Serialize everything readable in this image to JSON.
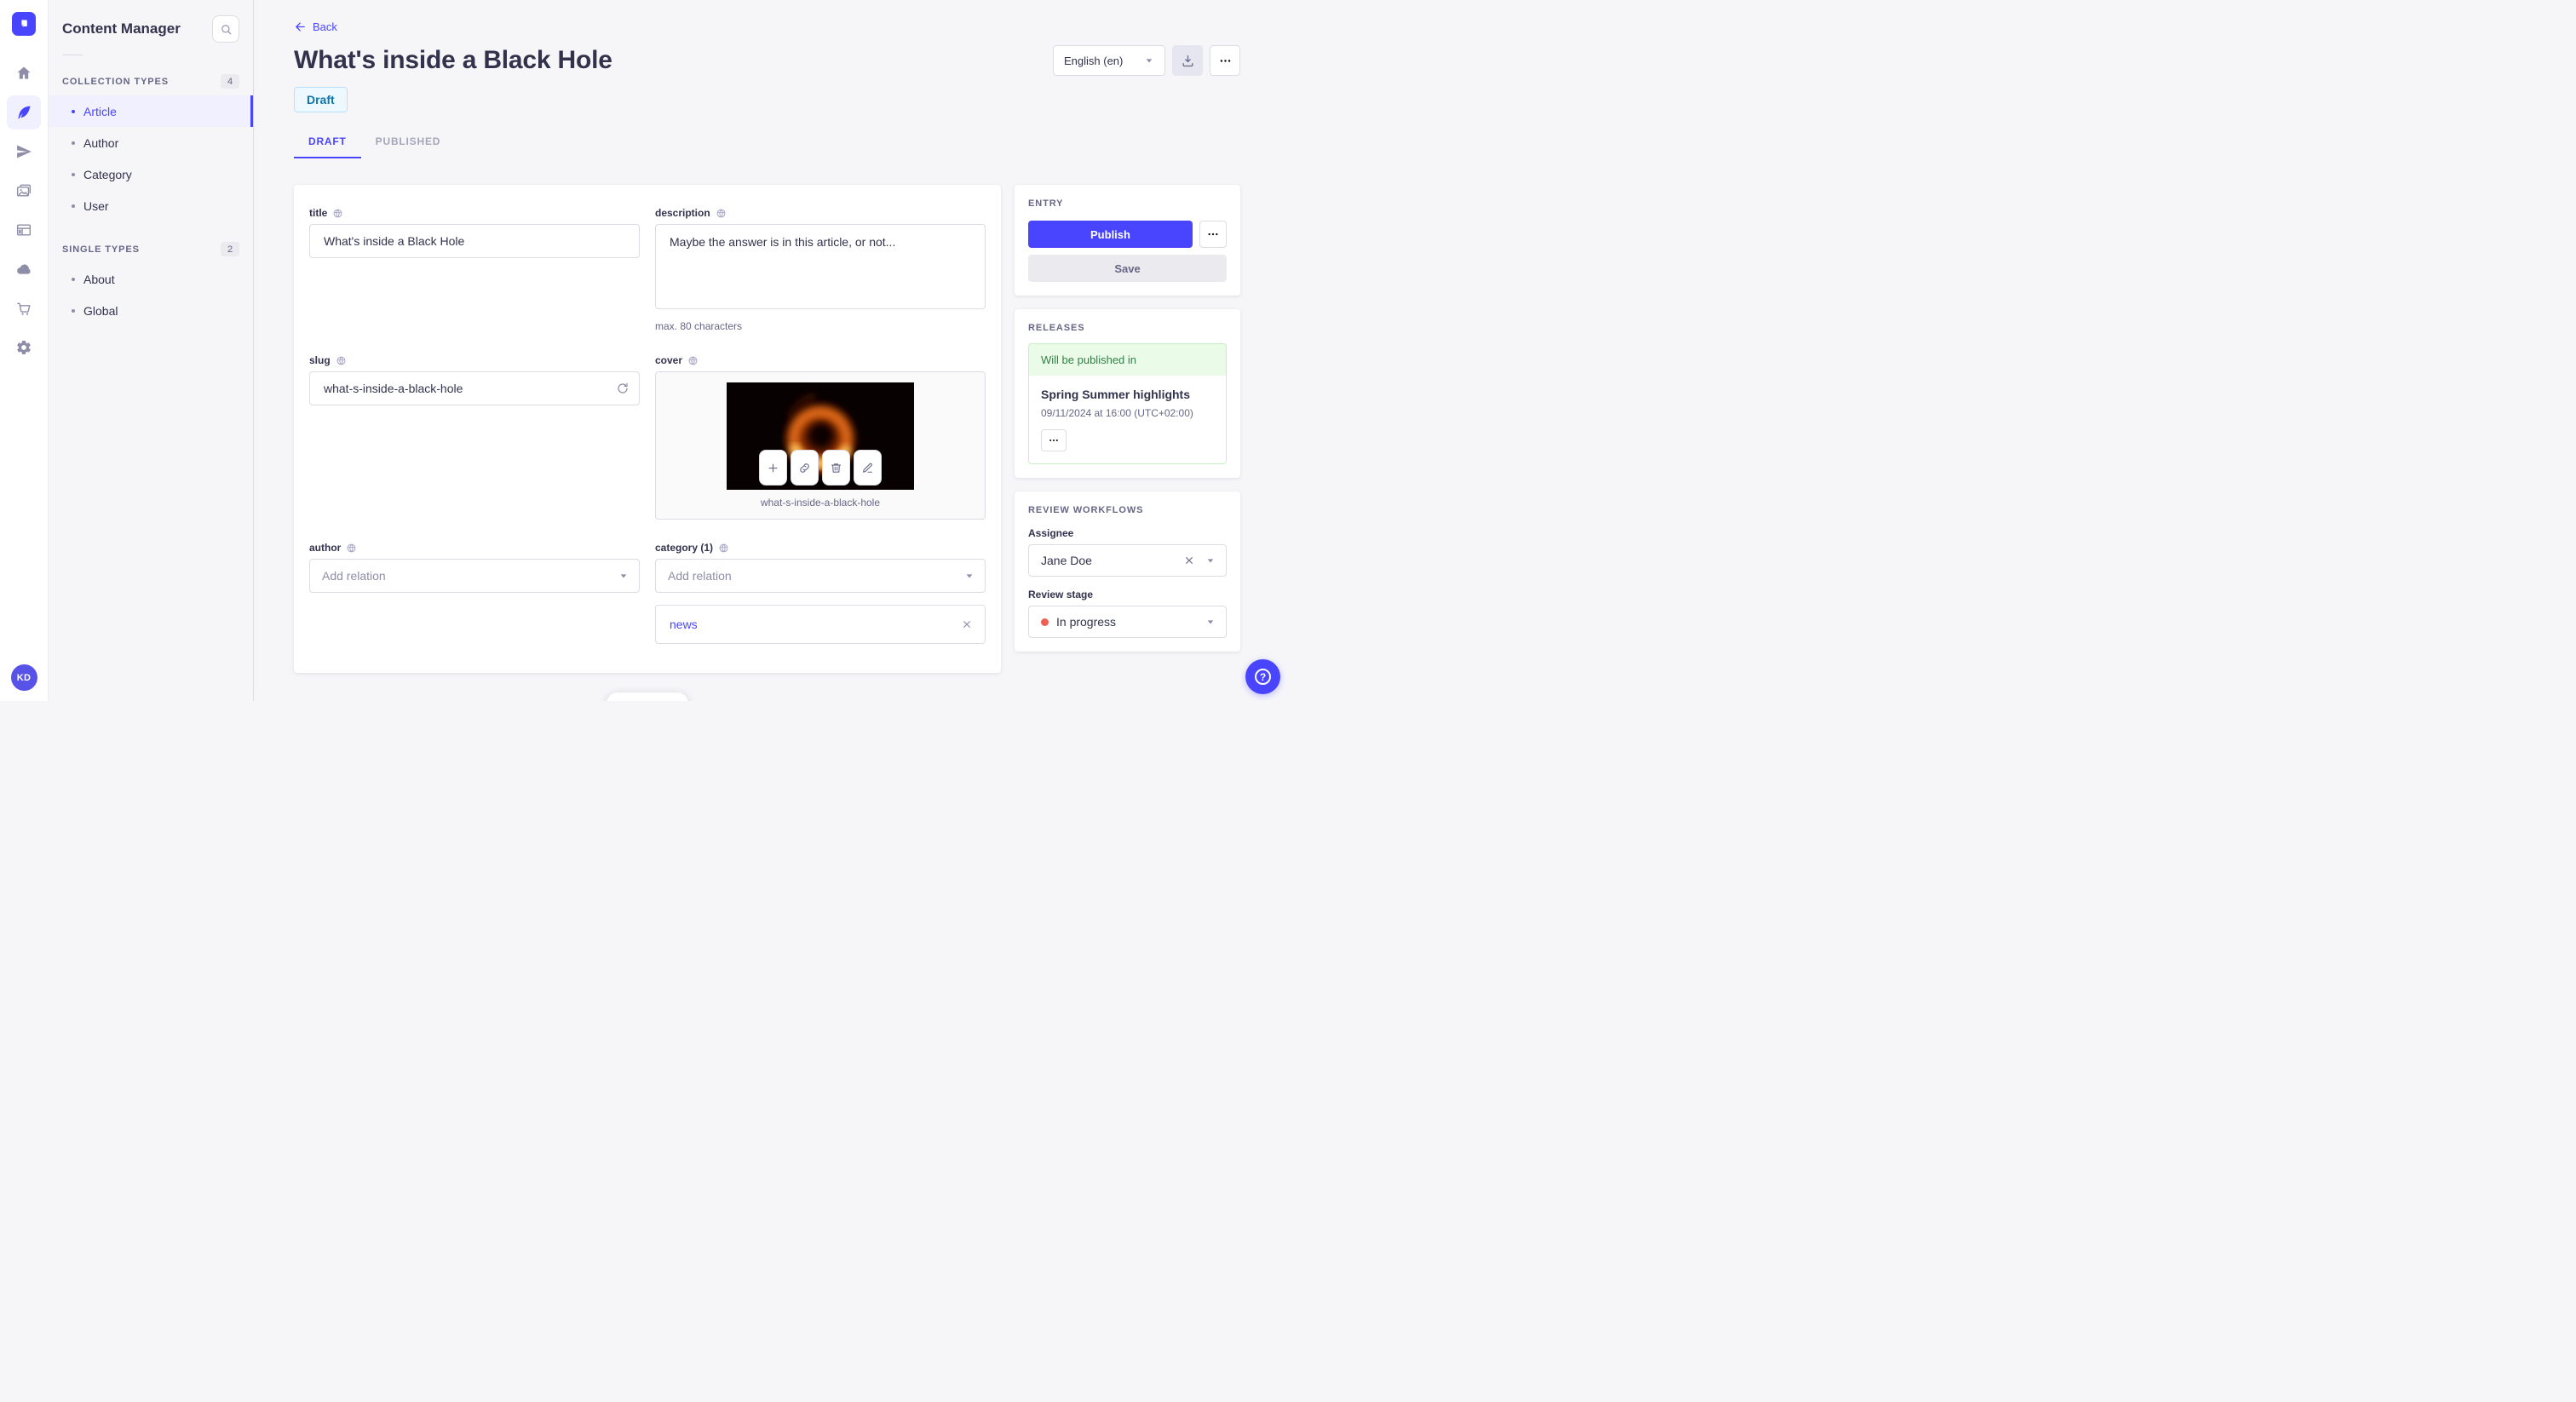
{
  "colors": {
    "primary": "#4945ff",
    "primary_bg": "#f0f0ff",
    "text": "#32324d",
    "muted": "#666687",
    "icon_gray": "#8e8ea9",
    "border": "#dcdce4",
    "draft_bg": "#eef8ff",
    "draft_border": "#b8e1ff",
    "draft_text": "#0c75af",
    "success_bg": "#eafbe7",
    "success_border": "#c6f0c2",
    "success_text": "#328048",
    "danger_dot": "#ee5e52"
  },
  "rail": {
    "logo_icon": "strapi-logo",
    "items": [
      {
        "icon": "home-icon",
        "active": false
      },
      {
        "icon": "content-manager-feather-icon",
        "active": true
      },
      {
        "icon": "paper-plane-icon",
        "active": false
      },
      {
        "icon": "media-library-images-icon",
        "active": false
      },
      {
        "icon": "content-type-builder-layout-icon",
        "active": false
      },
      {
        "icon": "cloud-icon",
        "active": false
      },
      {
        "icon": "marketplace-cart-icon",
        "active": false
      },
      {
        "icon": "settings-gear-icon",
        "active": false
      }
    ],
    "avatar_initials": "KD"
  },
  "subnav": {
    "title": "Content Manager",
    "search_icon": "search-icon",
    "sections": [
      {
        "label": "COLLECTION TYPES",
        "count": "4",
        "items": [
          {
            "label": "Article",
            "active": true
          },
          {
            "label": "Author",
            "active": false
          },
          {
            "label": "Category",
            "active": false
          },
          {
            "label": "User",
            "active": false
          }
        ]
      },
      {
        "label": "SINGLE TYPES",
        "count": "2",
        "items": [
          {
            "label": "About",
            "active": false
          },
          {
            "label": "Global",
            "active": false
          }
        ]
      }
    ]
  },
  "header": {
    "back_label": "Back",
    "page_title": "What's inside a Black Hole",
    "status_badge": "Draft",
    "locale_selected": "English (en)",
    "tabs": [
      {
        "label": "DRAFT",
        "active": true
      },
      {
        "label": "PUBLISHED",
        "active": false
      }
    ]
  },
  "form": {
    "title": {
      "label": "title",
      "value": "What's inside a Black Hole"
    },
    "description": {
      "label": "description",
      "value": "Maybe the answer is in this article, or not...",
      "hint": "max. 80 characters"
    },
    "slug": {
      "label": "slug",
      "value": "what-s-inside-a-black-hole"
    },
    "cover": {
      "label": "cover",
      "caption": "what-s-inside-a-black-hole"
    },
    "author": {
      "label": "author",
      "placeholder": "Add relation"
    },
    "category": {
      "label": "category (1)",
      "placeholder": "Add relation",
      "relations": [
        {
          "label": "news"
        }
      ]
    }
  },
  "entry_panel": {
    "heading": "ENTRY",
    "publish_label": "Publish",
    "save_label": "Save"
  },
  "releases_panel": {
    "heading": "RELEASES",
    "status_text": "Will be published in",
    "release_name": "Spring Summer highlights",
    "release_date": "09/11/2024 at 16:00 (UTC+02:00)"
  },
  "review_panel": {
    "heading": "REVIEW WORKFLOWS",
    "assignee_label": "Assignee",
    "assignee_value": "Jane Doe",
    "stage_label": "Review stage",
    "stage_value": "In progress"
  }
}
